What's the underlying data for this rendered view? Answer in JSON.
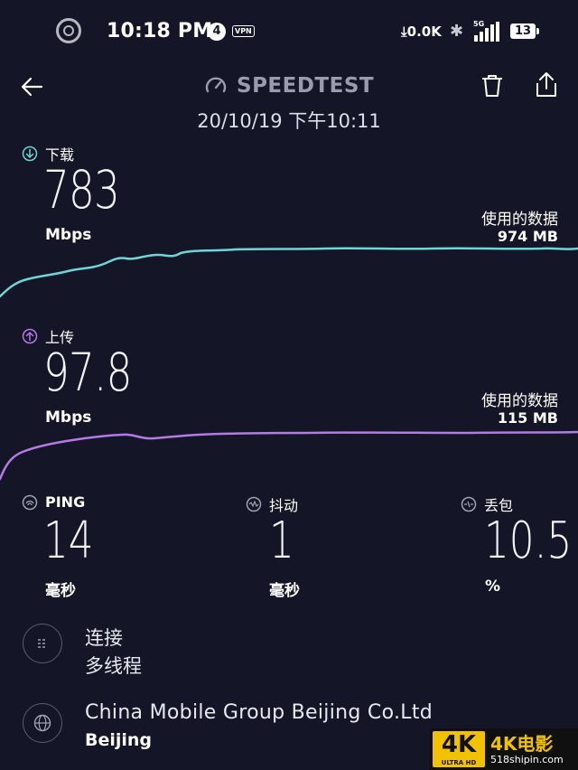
{
  "status_bar": {
    "time": "10:18 PM",
    "notification_count": "4",
    "vpn_label": "VPN",
    "net_speed": "0.0K",
    "network_type": "5G",
    "battery": "13"
  },
  "header": {
    "title": "SPEEDTEST",
    "date": "20/10/19 下午10:11"
  },
  "download": {
    "label": "下载",
    "value": "783",
    "unit": "Mbps",
    "data_used_label": "使用的数据",
    "data_used_value": "974 MB",
    "color": "#6fd6d8"
  },
  "upload": {
    "label": "上传",
    "value": "97.8",
    "unit": "Mbps",
    "data_used_label": "使用的数据",
    "data_used_value": "115 MB",
    "color": "#b57ae6"
  },
  "metrics": {
    "ping": {
      "label": "PING",
      "value": "14",
      "unit": "毫秒"
    },
    "jitter": {
      "label": "抖动",
      "value": "1",
      "unit": "毫秒"
    },
    "loss": {
      "label": "丢包",
      "value": "10.5",
      "unit": "%"
    }
  },
  "connection": {
    "title": "连接",
    "value": "多线程"
  },
  "provider": {
    "name": "China Mobile Group Beijing Co.Ltd",
    "location": "Beijing"
  },
  "watermark": {
    "badge": "4K",
    "badge_sub": "ULTRA HD",
    "title": "4K电影",
    "url": "518shipin.com"
  }
}
